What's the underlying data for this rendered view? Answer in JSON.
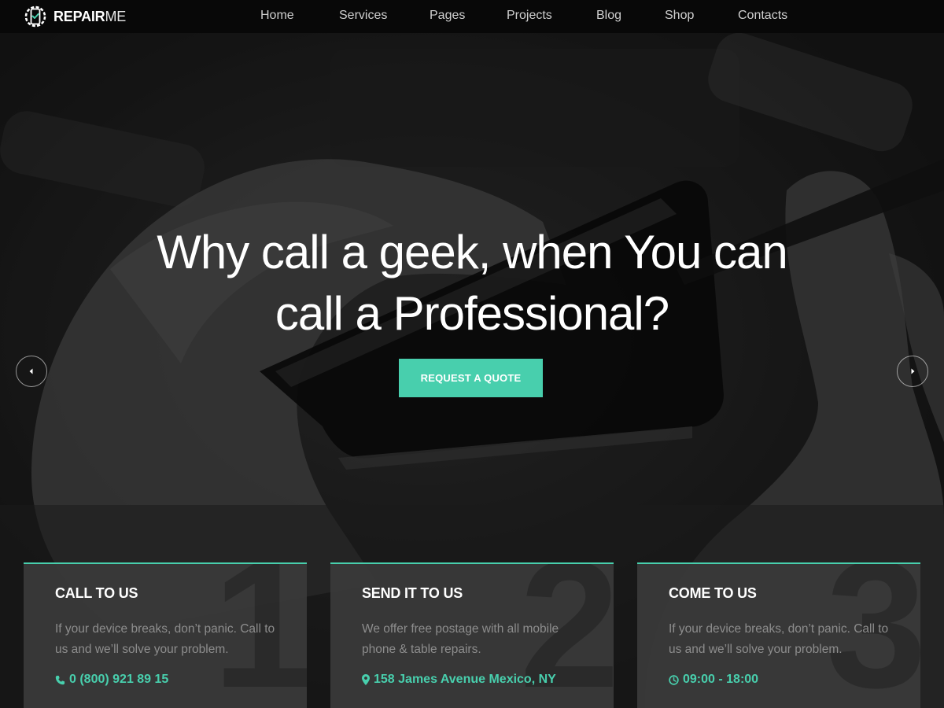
{
  "header": {
    "logo_icon": "phone-gear-icon",
    "logo_strong": "REPAIR",
    "logo_light": "ME",
    "nav": [
      {
        "label": "Home"
      },
      {
        "label": "Services"
      },
      {
        "label": "Pages"
      },
      {
        "label": "Projects"
      },
      {
        "label": "Blog"
      },
      {
        "label": "Shop"
      },
      {
        "label": "Contacts"
      }
    ]
  },
  "hero": {
    "title_line1": "Why call a geek, when You can",
    "title_line2": "call a Professional?",
    "cta_label": "REQUEST A QUOTE",
    "prev_icon": "chevron-left-icon",
    "next_icon": "chevron-right-icon"
  },
  "cards": [
    {
      "number": "1",
      "title": "CALL TO US",
      "text": "If your device breaks, don’t panic. Call to us and we’ll solve your problem.",
      "icon": "phone-icon",
      "contact": "0 (800) 921 89 15"
    },
    {
      "number": "2",
      "title": "SEND IT TO US",
      "text": "We offer free postage with all mobile phone & table repairs.",
      "icon": "map-marker-icon",
      "contact": "158 James Avenue Mexico, NY"
    },
    {
      "number": "3",
      "title": "COME TO US",
      "text": "If your device breaks, don’t panic. Call to us and we’ll solve your problem.",
      "icon": "clock-icon",
      "contact": "09:00 - 18:00"
    }
  ],
  "colors": {
    "accent": "#48cfad",
    "header_bg": "#080808",
    "card_bg": "#3a3a3a"
  }
}
